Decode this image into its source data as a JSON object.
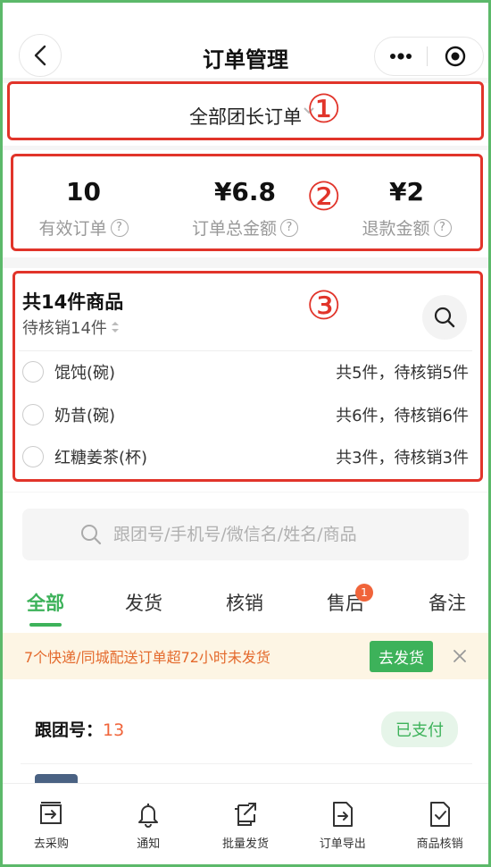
{
  "navbar": {
    "title": "订单管理"
  },
  "filter": {
    "label": "全部团长订单",
    "marker": "①"
  },
  "stats": {
    "marker": "②",
    "items": [
      {
        "value": "10",
        "label": "有效订单"
      },
      {
        "value": "¥6.8",
        "label": "订单总金额"
      },
      {
        "value": "¥2",
        "label": "退款金额"
      }
    ]
  },
  "goods": {
    "marker": "③",
    "title": "共14件商品",
    "subtitle": "待核销14件",
    "items": [
      {
        "name": "馄饨(碗)",
        "count": "共5件，待核销5件"
      },
      {
        "name": "奶昔(碗)",
        "count": "共6件，待核销6件"
      },
      {
        "name": "红糖姜茶(杯)",
        "count": "共3件，待核销3件"
      }
    ]
  },
  "search": {
    "placeholder": "跟团号/手机号/微信名/姓名/商品"
  },
  "tabs": [
    {
      "label": "全部",
      "active": true
    },
    {
      "label": "发货"
    },
    {
      "label": "核销"
    },
    {
      "label": "售后",
      "badge": "1"
    },
    {
      "label": "备注"
    }
  ],
  "notice": {
    "text": "7个快递/同城配送订单超72小时未发货",
    "button": "去发货"
  },
  "order": {
    "label": "跟团号：",
    "number": "13",
    "status": "已支付"
  },
  "bottom_bar": [
    {
      "label": "去采购",
      "icon": "purchase-icon"
    },
    {
      "label": "通知",
      "icon": "bell-icon"
    },
    {
      "label": "批量发货",
      "icon": "batch-ship-icon"
    },
    {
      "label": "订单导出",
      "icon": "export-icon"
    },
    {
      "label": "商品核销",
      "icon": "verify-icon"
    }
  ],
  "colors": {
    "accent": "#3db25a",
    "annotation_red": "#e1342a",
    "warning_orange": "#e46a2d",
    "badge": "#f0643a"
  }
}
